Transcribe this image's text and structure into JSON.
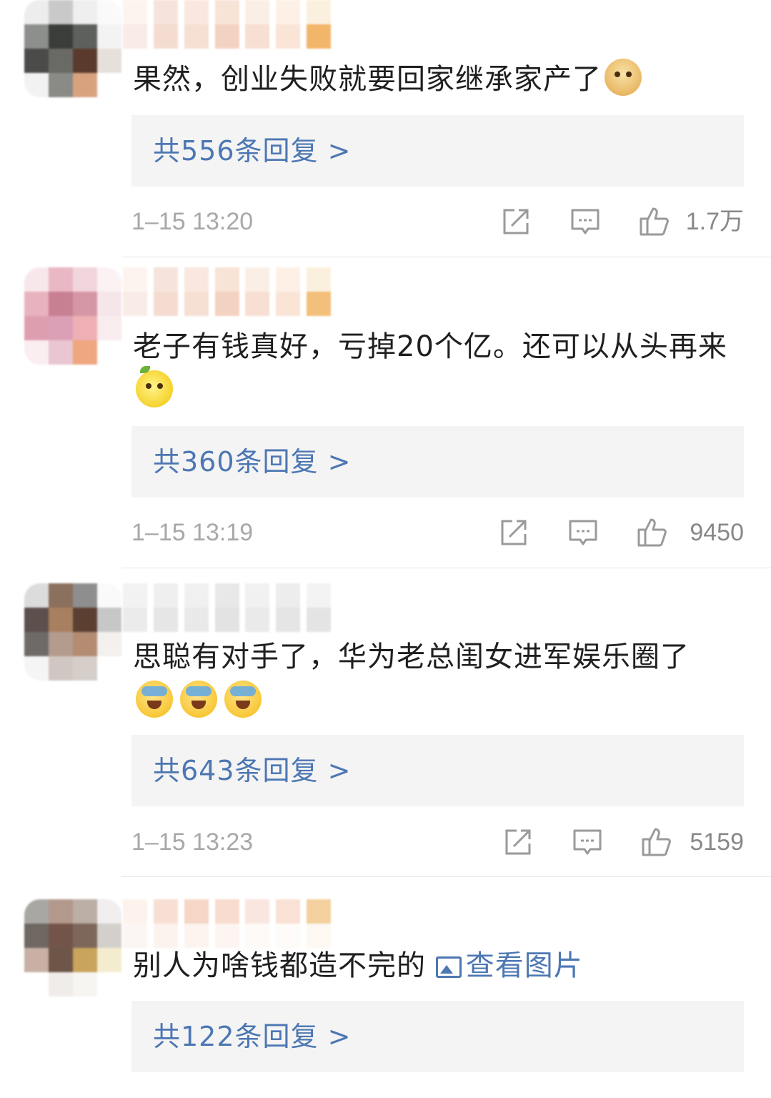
{
  "comments": [
    {
      "text": "果然，创业失败就要回家继承家产了",
      "emojis": [
        "doge"
      ],
      "reply_label": "共556条回复 >",
      "time": "1–15 13:20",
      "likes": "1.7万"
    },
    {
      "text": "老子有钱真好，亏掉20个亿。还可以从头再来",
      "emojis": [
        "lemon"
      ],
      "reply_label": "共360条回复 >",
      "time": "1–15 13:19",
      "likes": "9450"
    },
    {
      "text": "思聪有对手了，华为老总闺女进军娱乐圈了",
      "emojis": [
        "laugh-cry",
        "laugh-cry",
        "laugh-cry"
      ],
      "reply_label": "共643条回复 >",
      "time": "1–15 13:23",
      "likes": "5159"
    },
    {
      "text": "别人为啥钱都造不完的",
      "image_link": "查看图片",
      "reply_label": "共122条回复 >"
    }
  ],
  "icons": {
    "share": "share-icon",
    "comment": "comment-icon",
    "like": "thumbs-up-icon",
    "picture": "picture-icon"
  },
  "colors": {
    "link": "#4d77b3",
    "reply_bg": "#f4f4f4",
    "meta_text": "#a8a8a8"
  }
}
